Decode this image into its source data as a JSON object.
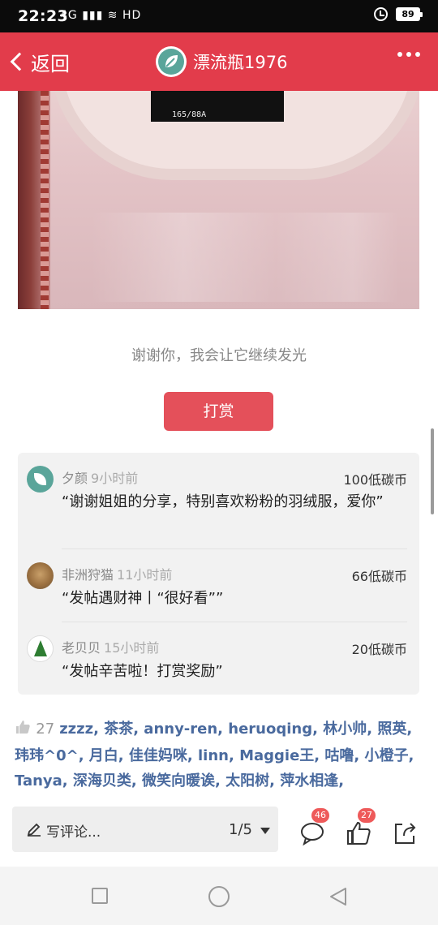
{
  "status_bar": {
    "time": "22:23",
    "signal": "4G",
    "network": "HD",
    "battery": "89"
  },
  "header": {
    "back_label": "返回",
    "title": "漂流瓶1976",
    "brand_color": "#e23c4b"
  },
  "photo": {
    "tag_text": "165/88A"
  },
  "caption": "谢谢你，我会让它继续发光",
  "reward_button": "打赏",
  "rewards": [
    {
      "name": "夕颜",
      "time": "9小时前",
      "amount": "100低碳币",
      "message": "“谢谢姐姐的分享，特别喜欢粉粉的羽绒服，爱你”"
    },
    {
      "name": "非洲狩猫",
      "time": "11小时前",
      "amount": "66低碳币",
      "message": "“发帖遇财神丨“很好看””"
    },
    {
      "name": "老贝贝",
      "time": "15小时前",
      "amount": "20低碳币",
      "message": "“发帖辛苦啦！打赏奖励”"
    }
  ],
  "likes": {
    "count": "27",
    "names": "zzzz, 茶茶, anny-ren, heruoqing, 林小帅, 照英, 玮玮^0^, 月白, 佳佳妈咪, linn, Maggie王, 咕噜, 小橙子, Tanya, 深海贝类, 微笑向暖诶, 太阳树, 萍水相逢,"
  },
  "comment_bar": {
    "placeholder": "写评论...",
    "page_indicator": "1/5",
    "comment_count": "46",
    "like_count": "27"
  }
}
